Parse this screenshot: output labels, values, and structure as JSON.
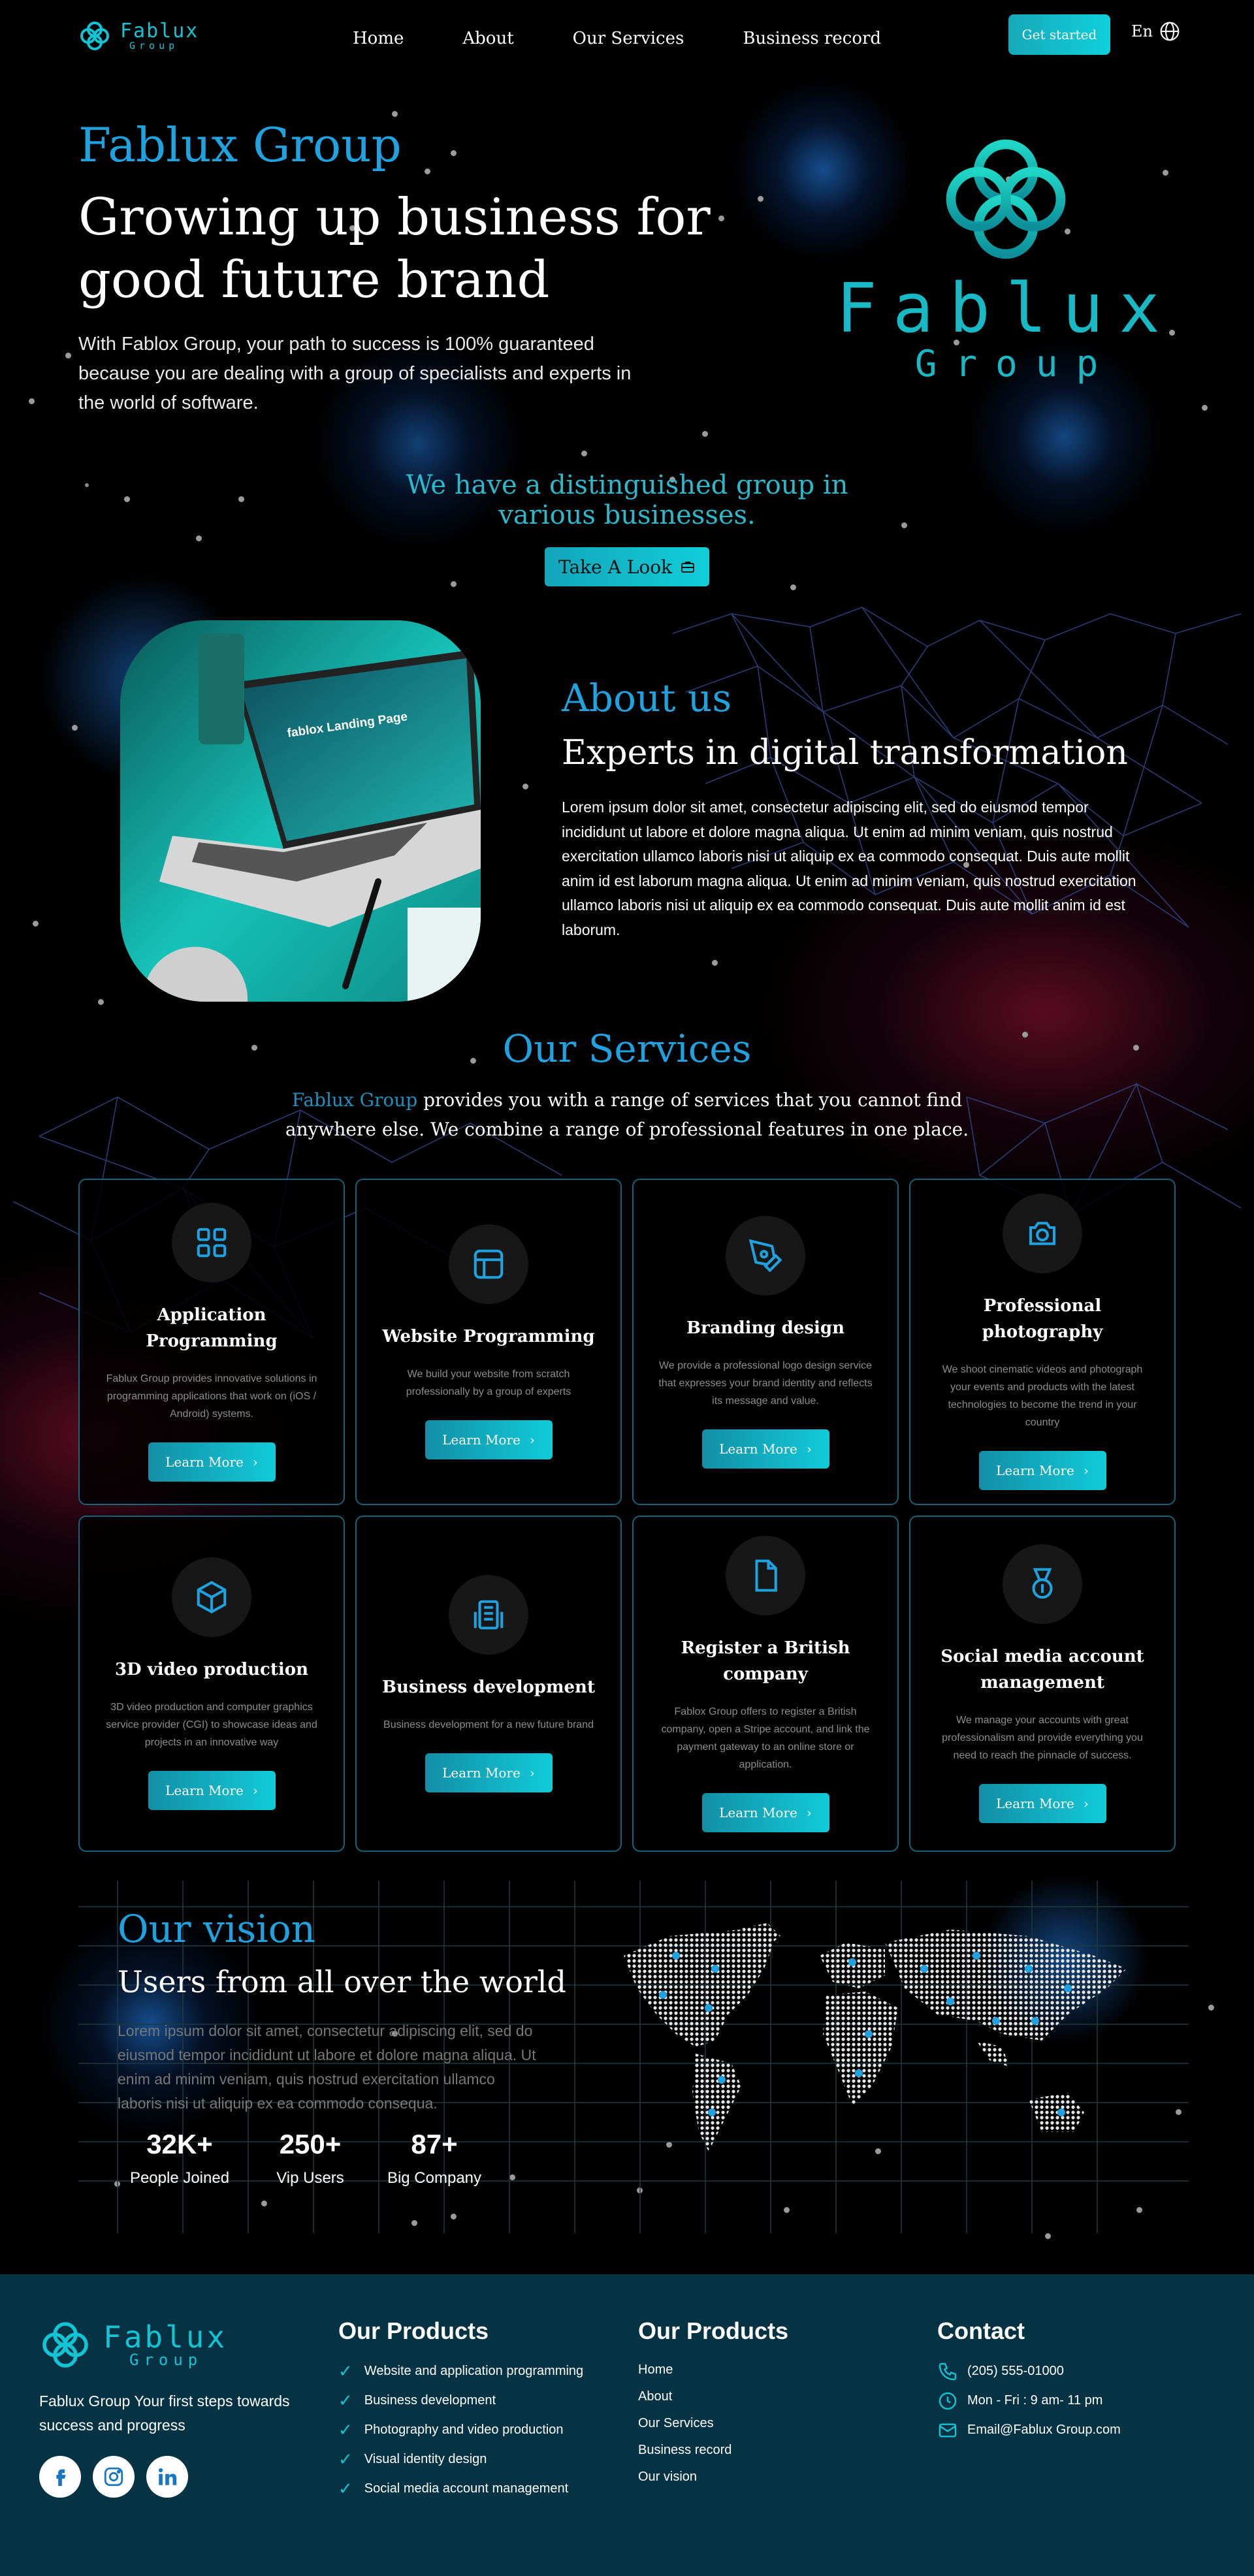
{
  "nav": {
    "logo_main": "Fablux",
    "logo_sub": "Group",
    "links": [
      "Home",
      "About",
      "Our Services",
      "Business record"
    ],
    "cta": "Get started",
    "lang": "En"
  },
  "hero": {
    "brand": "Fablux Group",
    "title": "Growing up business for good future brand",
    "text": "With Fablox Group, your path to success is 100% guaranteed because you are dealing with a group of specialists and experts in the world of software.",
    "logo_main": "Fablux",
    "logo_sub": "Group",
    "tagline": "We have a distinguished group in various businesses.",
    "button": "Take A Look"
  },
  "about": {
    "label": "About us",
    "title": "Experts in digital transformation",
    "text": "Lorem ipsum dolor sit amet, consectetur adipiscing elit, sed do eiusmod tempor incididunt ut labore et dolore magna aliqua. Ut enim ad minim veniam, quis nostrud exercitation ullamco laboris nisi ut aliquip ex ea commodo consequat. Duis aute mollit anim id est laborum magna aliqua. Ut enim ad minim veniam, quis nostrud exercitation ullamco laboris nisi ut aliquip ex ea commodo consequat. Duis aute mollit anim id est laborum.",
    "image_caption": "fablox Landing Page"
  },
  "services": {
    "title": "Our Services",
    "sub_highlight": "Fablux Group",
    "sub_rest": " provides you with a range of services that you cannot find anywhere else. We combine a range of professional features in one place.",
    "cards": [
      {
        "icon": "grid-icon",
        "title": "Application Programming",
        "text": "Fablux Group provides innovative solutions in programming applications that work on (iOS / Android) systems.",
        "button": "Learn More"
      },
      {
        "icon": "browser-window-icon",
        "title": "Website Programming",
        "text": "We build your website from scratch professionally by a group of experts",
        "button": "Learn More"
      },
      {
        "icon": "pen-tool-icon",
        "title": "Branding design",
        "text": "We provide a professional logo design service that expresses your brand identity and reflects its message and value.",
        "button": "Learn More"
      },
      {
        "icon": "camera-icon",
        "title": "Professional photography",
        "text": "We shoot cinematic videos and photograph your events and products with the latest technologies to become the trend in your country",
        "button": "Learn More"
      },
      {
        "icon": "cube-icon",
        "title": "3D video production",
        "text": "3D video production and computer graphics service provider (CGI) to showcase ideas and projects in an innovative way",
        "button": "Learn More"
      },
      {
        "icon": "building-icon",
        "title": "Business development",
        "text": "Business development for a new future brand",
        "button": "Learn More"
      },
      {
        "icon": "document-icon",
        "title": "Register a British company",
        "text": "Fablox Group offers to register a British company, open a Stripe account, and link the payment gateway to an online store or application.",
        "button": "Learn More"
      },
      {
        "icon": "medal-icon",
        "title": "Social media account management",
        "text": "We manage your accounts with great professionalism and provide everything you need to reach the pinnacle of success.",
        "button": "Learn More"
      }
    ]
  },
  "vision": {
    "label": "Our vision",
    "title": "Users from all over the world",
    "text": "Lorem ipsum dolor sit amet, consectetur adipiscing elit, sed do eiusmod tempor incididunt ut labore et dolore magna aliqua. Ut enim ad minim veniam, quis nostrud exercitation ullamco laboris nisi ut aliquip ex ea commodo consequa.",
    "stats": [
      {
        "num": "32K+",
        "label": "People Joined"
      },
      {
        "num": "250+",
        "label": "Vip Users"
      },
      {
        "num": "87+",
        "label": "Big Company"
      }
    ]
  },
  "footer": {
    "logo_main": "Fablux",
    "logo_sub": "Group",
    "tagline": "Fablux Group Your first steps towards success and progress",
    "social": [
      "facebook-icon",
      "instagram-icon",
      "linkedin-icon"
    ],
    "products_title": "Our Products",
    "products": [
      "Website and application programming",
      "Business development",
      "Photography and video production",
      "Visual identity design",
      "Social media account management"
    ],
    "links_title": "Our Products",
    "links": [
      "Home",
      "About",
      "Our Services",
      "Business record",
      "Our vision"
    ],
    "contact_title": "Contact",
    "contact": [
      {
        "icon": "phone-icon",
        "text": "(205) 555-01000"
      },
      {
        "icon": "clock-icon",
        "text": "Mon - Fri : 9 am- 11 pm"
      },
      {
        "icon": "mail-icon",
        "text": "Email@Fablux Group.com"
      }
    ]
  },
  "colors": {
    "accent": "#1fa3e0",
    "teal": "#13c4d4",
    "footer_bg": "#053343"
  }
}
